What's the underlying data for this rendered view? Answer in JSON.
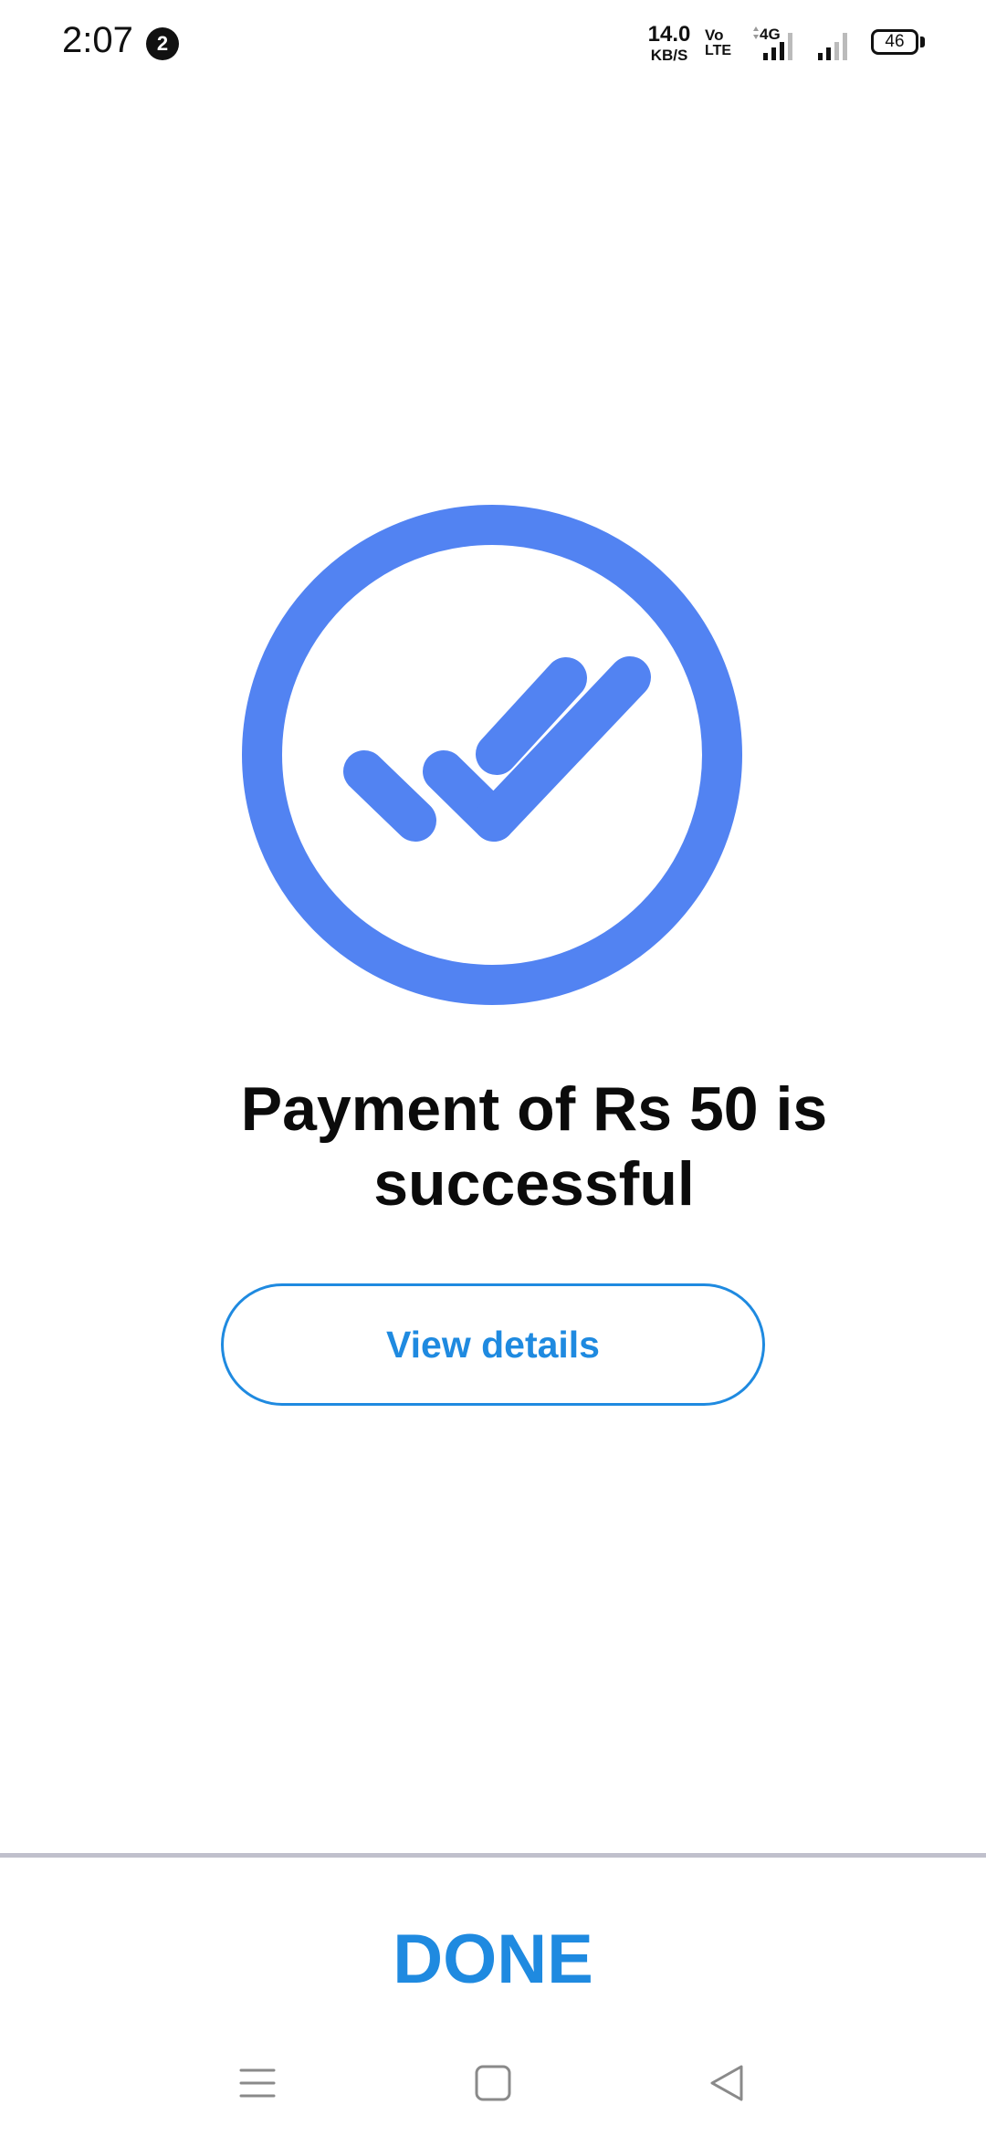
{
  "status_bar": {
    "time": "2:07",
    "notification_count": "2",
    "net_speed_value": "14.0",
    "net_speed_unit": "KB/S",
    "volte_top": "Vo",
    "volte_bottom": "LTE",
    "network_type": "4G",
    "battery_level": "46"
  },
  "main": {
    "success_icon": "double-check-circle-icon",
    "message": "Payment of Rs 50 is successful",
    "view_details_label": "View details"
  },
  "footer": {
    "done_label": "DONE"
  },
  "nav_bar": {
    "menu_icon": "menu-icon",
    "home_icon": "home-icon",
    "back_icon": "back-icon"
  },
  "colors": {
    "icon_blue": "#5283f2",
    "accent_blue": "#1f8ae0",
    "divider": "#c0c0cc",
    "text": "#0b0b0b"
  }
}
